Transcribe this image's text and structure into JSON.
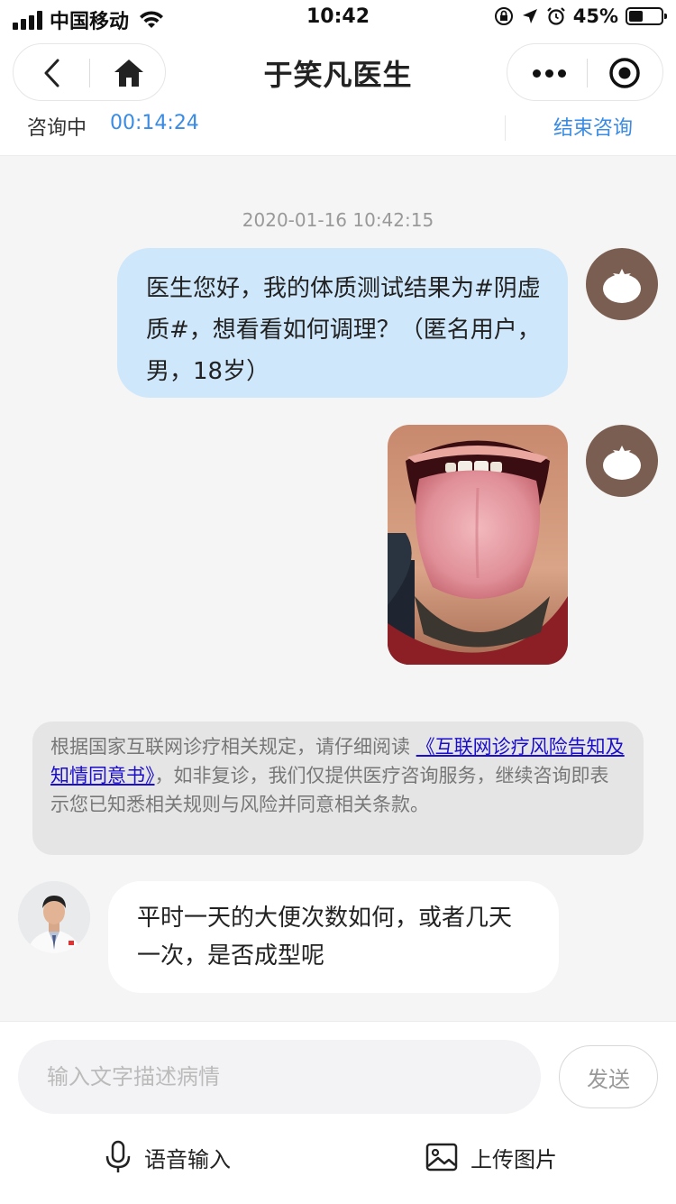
{
  "status_bar": {
    "carrier": "中国移动",
    "time": "10:42",
    "battery_pct": "45%",
    "battery_level": 0.45
  },
  "nav": {
    "title": "于笑凡医生"
  },
  "consult": {
    "status": "咨询中",
    "timer": "00:14:24",
    "end_label": "结束咨询"
  },
  "chat": {
    "timestamp": "2020-01-16 10:42:15",
    "user_message": "医生您好，我的体质测试结果为#阴虚质#，想看看如何调理？（匿名用户，男，18岁）",
    "notice": {
      "prefix": "根据国家互联网诊疗相关规定，请仔细阅读 ",
      "link": "《互联网诊疗风险告知及知情同意书》",
      "suffix": "，如非复诊，我们仅提供医疗咨询服务，继续咨询即表示您已知悉相关规则与风险并同意相关条款。"
    },
    "doctor_message": "平时一天的大便次数如何，或者几天一次，是否成型呢"
  },
  "input": {
    "placeholder": "输入文字描述病情",
    "value": "",
    "send_label": "发送",
    "voice_label": "语音输入",
    "photo_label": "上传图片"
  },
  "colors": {
    "accent": "#3a8be3",
    "user_bubble": "#cfe7fb",
    "user_avatar": "#7b5e52",
    "link": "#1a0dcc"
  },
  "icons": [
    "signal-icon",
    "wifi-icon",
    "lock-rotation-icon",
    "location-arrow-icon",
    "alarm-icon",
    "battery-icon",
    "back-icon",
    "home-icon",
    "more-icon",
    "close-target-icon",
    "tomato-avatar-icon",
    "microphone-icon",
    "image-icon"
  ]
}
